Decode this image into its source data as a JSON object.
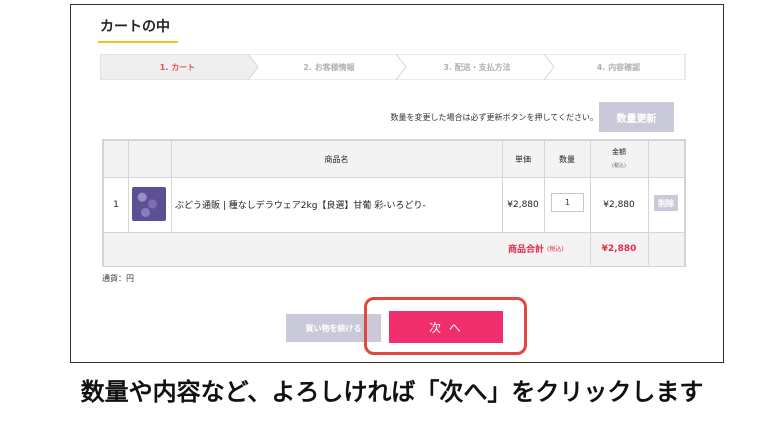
{
  "cart": {
    "title": "カートの中",
    "steps": [
      "1. カート",
      "2. お客様情報",
      "3. 配送・支払方法",
      "4. 内容確認"
    ],
    "active_step_color": "#e64b4b",
    "notice": "数量を変更した場合は必ず更新ボタンを押してください。",
    "update_button": "数量更新",
    "table": {
      "headers": {
        "product_name": "商品名",
        "unit_price": "単価",
        "quantity": "数量",
        "amount": "金額",
        "amount_note": "(税込)"
      },
      "rows": [
        {
          "index": "1",
          "name": "ぶどう通販 | 種なしデラウェア2kg【良選】甘葡 彩-いろどり-",
          "unit_price": "¥2,880",
          "quantity": "1",
          "amount": "¥2,880",
          "delete_label": "削除"
        }
      ],
      "total_label": "商品合計",
      "total_note": "(税込)",
      "total_value": "¥2,880"
    },
    "currency": "通貨：円",
    "continue_button": "買い物を続ける",
    "next_button": "次 へ"
  },
  "caption": "数量や内容など、よろしければ「次へ」をクリックします",
  "colors": {
    "accent_pink": "#ef2e6b",
    "highlight_red": "#e0483f",
    "button_gray": "#c9c9d9",
    "title_underline": "#f0c419"
  },
  "icons": [
    "grape-product-thumbnail"
  ]
}
